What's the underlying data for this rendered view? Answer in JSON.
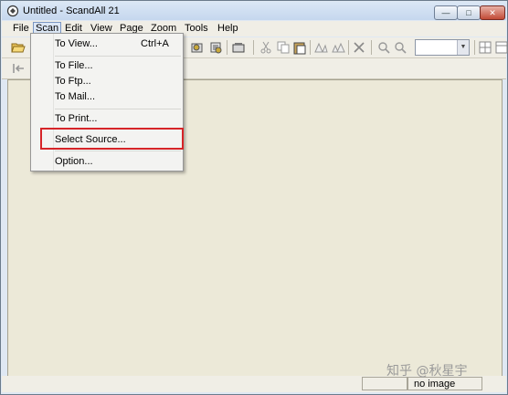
{
  "window": {
    "title": "Untitled - ScandAll 21",
    "controls": {
      "minimize": "—",
      "maximize": "□",
      "close": "✕"
    }
  },
  "menubar": {
    "items": [
      "File",
      "Scan",
      "Edit",
      "View",
      "Page",
      "Zoom",
      "Tools",
      "Help"
    ],
    "active": "Scan"
  },
  "scan_menu": {
    "to_view": "To View...",
    "to_view_shortcut": "Ctrl+A",
    "to_file": "To File...",
    "to_ftp": "To Ftp...",
    "to_mail": "To Mail...",
    "to_print": "To Print...",
    "select_source": "Select Source...",
    "option": "Option...",
    "highlighted_item": "Select Source..."
  },
  "toolbar": {
    "icons": [
      "open-folder-icon",
      "scan-icon",
      "scan-batch-icon",
      "scan-settings-icon",
      "cut-icon",
      "copy-icon",
      "paste-icon",
      "rotate-left-icon",
      "rotate-right-icon",
      "delete-icon",
      "zoom-in-icon",
      "zoom-out-icon",
      "fit-page-icon",
      "fit-width-icon"
    ],
    "zoom_combo_value": ""
  },
  "toolbar2": {
    "icons": [
      "first-page-icon"
    ]
  },
  "statusbar": {
    "image_status": "no image"
  },
  "watermark": {
    "text": "知乎 @秋星宇"
  },
  "colors": {
    "client_background": "#ece9d8",
    "highlight_border": "#d62428",
    "titlebar": "#c5d7ee"
  }
}
